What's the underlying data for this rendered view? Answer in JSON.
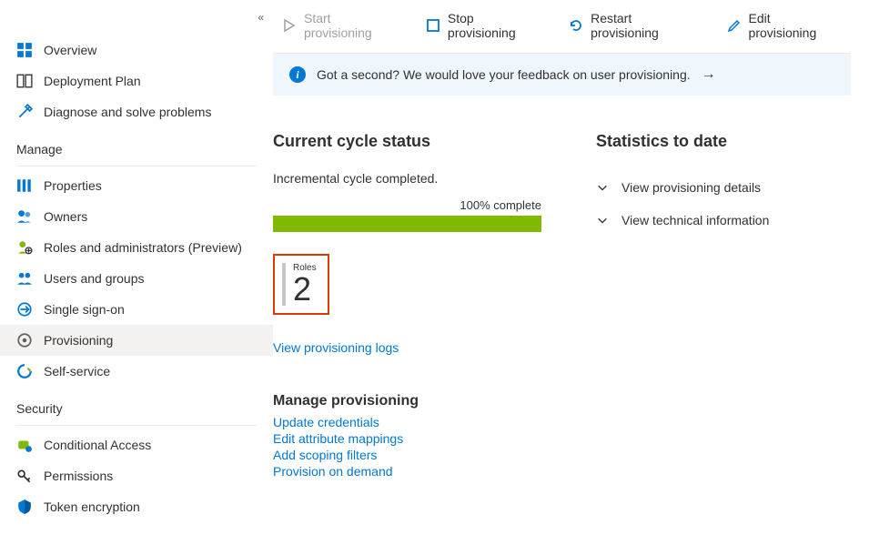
{
  "sidebar": {
    "top": [
      {
        "label": "Overview"
      },
      {
        "label": "Deployment Plan"
      },
      {
        "label": "Diagnose and solve problems"
      }
    ],
    "manage_header": "Manage",
    "manage": [
      {
        "label": "Properties"
      },
      {
        "label": "Owners"
      },
      {
        "label": "Roles and administrators (Preview)"
      },
      {
        "label": "Users and groups"
      },
      {
        "label": "Single sign-on"
      },
      {
        "label": "Provisioning"
      },
      {
        "label": "Self-service"
      }
    ],
    "security_header": "Security",
    "security": [
      {
        "label": "Conditional Access"
      },
      {
        "label": "Permissions"
      },
      {
        "label": "Token encryption"
      }
    ]
  },
  "toolbar": {
    "start": "Start provisioning",
    "stop": "Stop provisioning",
    "restart": "Restart provisioning",
    "edit": "Edit provisioning"
  },
  "banner": {
    "text": "Got a second? We would love your feedback on user provisioning."
  },
  "cycle": {
    "heading": "Current cycle status",
    "status_text": "Incremental cycle completed.",
    "progress_label": "100% complete",
    "roles_label": "Roles",
    "roles_count": "2",
    "view_logs": "View provisioning logs"
  },
  "stats": {
    "heading": "Statistics to date",
    "details": "View provisioning details",
    "technical": "View technical information"
  },
  "manage_prov": {
    "heading": "Manage provisioning",
    "links": {
      "credentials": "Update credentials",
      "mappings": "Edit attribute mappings",
      "filters": "Add scoping filters",
      "demand": "Provision on demand"
    }
  }
}
